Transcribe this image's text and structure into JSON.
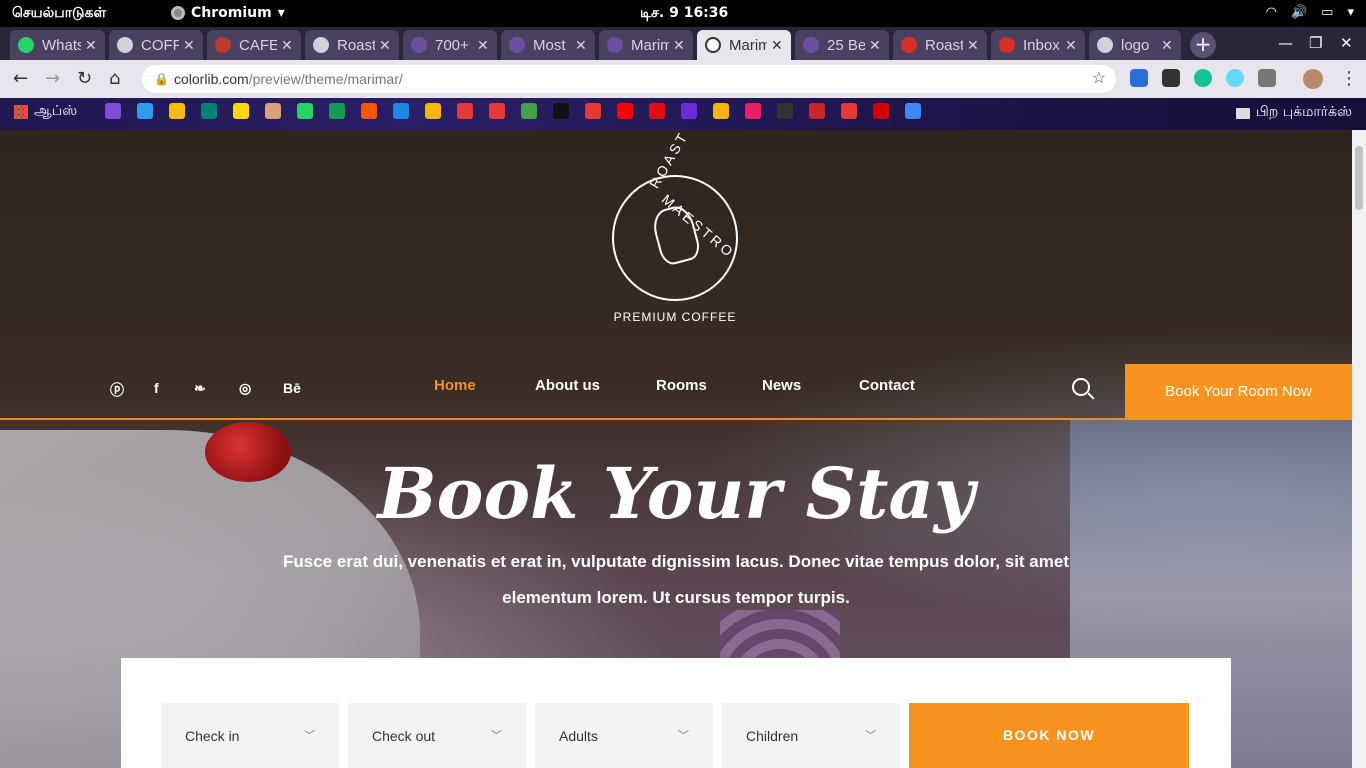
{
  "system": {
    "activities": "செயல்பாடுகள்",
    "app_name": "Chromium",
    "clock": "டிச. 9  16:36"
  },
  "tabs": [
    {
      "label": "WhatsApp",
      "favicon_color": "#25d366",
      "active": false
    },
    {
      "label": "COFFEE",
      "favicon_color": "#cfd2da",
      "active": false
    },
    {
      "label": "CAFE",
      "favicon_color": "#c0392b",
      "active": false
    },
    {
      "label": "Roast",
      "favicon_color": "#cfd2da",
      "active": false
    },
    {
      "label": "700+",
      "favicon_color": "#6b4fa0",
      "active": false
    },
    {
      "label": "Most",
      "favicon_color": "#6b4fa0",
      "active": false
    },
    {
      "label": "Marimar",
      "favicon_color": "#6b4fa0",
      "active": false
    },
    {
      "label": "Marimar",
      "favicon_color": "#ffffff",
      "active": true
    },
    {
      "label": "25 Be",
      "favicon_color": "#6b4fa0",
      "active": false
    },
    {
      "label": "Roast",
      "favicon_color": "#d93025",
      "active": false
    },
    {
      "label": "Inbox",
      "favicon_color": "#d93025",
      "active": false
    },
    {
      "label": "logo",
      "favicon_color": "#cfd2da",
      "active": false
    }
  ],
  "toolbar": {
    "url_domain": "colorlib.com",
    "url_path": "/preview/theme/marimar/"
  },
  "bookmarks": {
    "apps_label": "ஆப்ஸ்",
    "other_label": "பிற புக்மார்க்ஸ்",
    "icons": [
      "#7b4fd6",
      "#2a9df4",
      "#fbbc04",
      "#008373",
      "#ffd600",
      "#d9a27a",
      "#25d366",
      "#0f9d58",
      "#ff5500",
      "#1e88e5",
      "#f5b700",
      "#e53935",
      "#e53935",
      "#43a047",
      "#111111",
      "#e53935",
      "#ff0000",
      "#e50914",
      "#6c2bd9",
      "#f4b400",
      "#e91e63",
      "#333333",
      "#c62828",
      "#e53935",
      "#d50000",
      "#4285f4"
    ]
  },
  "site": {
    "logo_text_1": "ROAST",
    "logo_text_2": "MAESTRO",
    "tagline": "PREMIUM COFFEE",
    "social": [
      "pinterest-icon",
      "facebook-icon",
      "twitter-icon",
      "dribbble-icon",
      "behance-icon"
    ],
    "social_glyphs": [
      "ⓟ",
      "f",
      "❧",
      "◎",
      "Bē"
    ],
    "menu": {
      "home": "Home",
      "about": "About us",
      "rooms": "Rooms",
      "news": "News",
      "contact": "Contact"
    },
    "cta": "Book Your Room Now",
    "hero_title": "Book Your Stay",
    "hero_subtitle": "Fusce erat dui, venenatis et erat in, vulputate dignissim lacus. Donec vitae tempus dolor, sit amet elementum lorem. Ut cursus tempor turpis.",
    "booking": {
      "check_in": "Check in",
      "check_out": "Check out",
      "adults": "Adults",
      "children": "Children",
      "submit": "BOOK NOW"
    },
    "accent": "#f7931e"
  }
}
